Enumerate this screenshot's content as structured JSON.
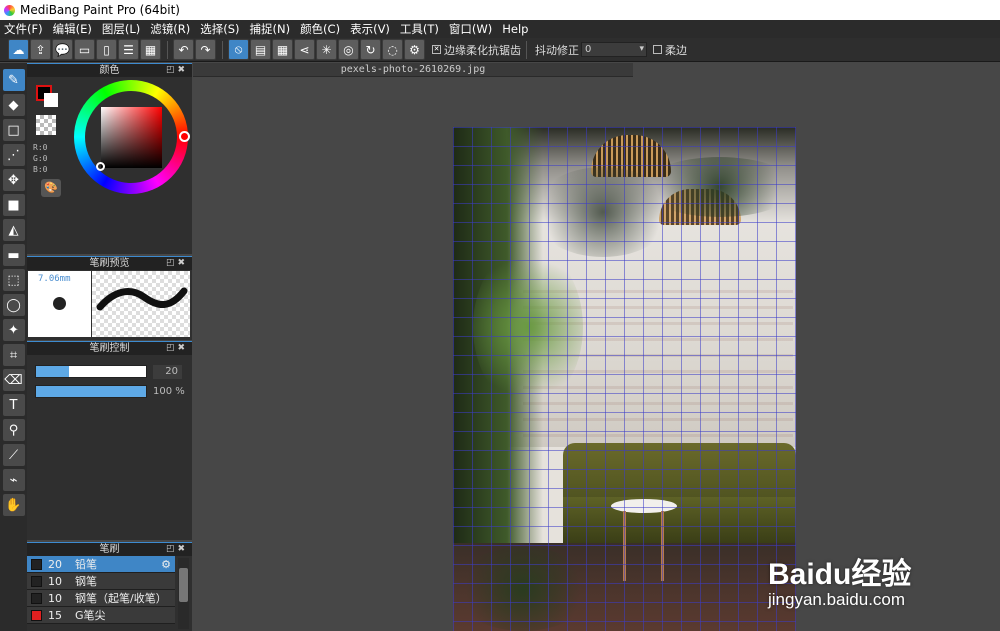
{
  "window": {
    "title": "MediBang Paint Pro (64bit)"
  },
  "menu": [
    "文件(F)",
    "编辑(E)",
    "图层(L)",
    "滤镜(R)",
    "选择(S)",
    "捕捉(N)",
    "颜色(C)",
    "表示(V)",
    "工具(T)",
    "窗口(W)",
    "Help"
  ],
  "toolbar": {
    "antialias_label": "边缘柔化抗锯齿",
    "antialias_checked": true,
    "stabilizer_label": "抖动修正",
    "stabilizer_value": "0",
    "soft_edge_label": "柔边",
    "soft_edge_checked": false
  },
  "color_panel": {
    "title": "颜色",
    "r": "R:0",
    "g": "G:0",
    "b": "B:0",
    "primary_color": "#000000",
    "secondary_color": "#ffffff"
  },
  "brush_preview": {
    "title": "笔刷预览",
    "size_label": "7.06mm"
  },
  "brush_control": {
    "title": "笔刷控制",
    "size_value": "20",
    "size_fraction": 0.3,
    "opacity_value": "100 %",
    "opacity_fraction": 1.0
  },
  "brush_panel": {
    "title": "笔刷",
    "items": [
      {
        "size": "20",
        "name": "铅笔",
        "color": "#222222",
        "active": true
      },
      {
        "size": "10",
        "name": "钢笔",
        "color": "#222222",
        "active": false
      },
      {
        "size": "10",
        "name": "钢笔（起笔/收笔）",
        "color": "#222222",
        "active": false
      },
      {
        "size": "15",
        "name": "G笔尖",
        "color": "#e02020",
        "active": false
      }
    ]
  },
  "document": {
    "tab_title": "pexels-photo-2610269.jpg"
  },
  "watermark": {
    "brand": "Baidu经验",
    "url": "jingyan.baidu.com"
  }
}
